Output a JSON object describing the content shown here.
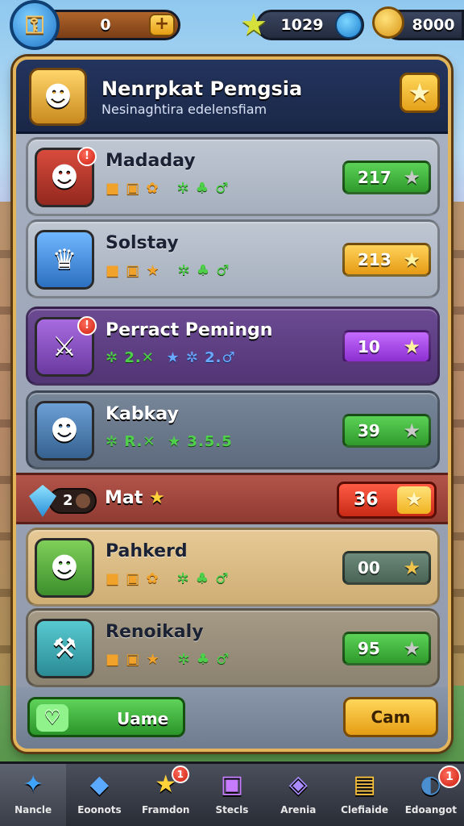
{
  "hud": {
    "keys": "0",
    "gems": "1029",
    "coins": "8000"
  },
  "header": {
    "title": "Nenrpkat Pemgsia",
    "subtitle": "Nesinaghtira edelensfiam"
  },
  "players": [
    {
      "name": "Madaday",
      "score": "217",
      "stats": [
        "⬛",
        "⬛",
        "⬛"
      ],
      "stats_text": [
        "■ ▣ ✿",
        "✲ ♣ ♂"
      ],
      "badge": "!"
    },
    {
      "name": "Solstay",
      "score": "213",
      "stats_text": [
        "■ ▣ ★",
        "✲ ♣ ♂"
      ],
      "badge": ""
    },
    {
      "name": "Perract Pemingn",
      "score": "10",
      "stats_text": [
        "✲ 2.✕",
        "★ ✲ 2.♂"
      ],
      "badge": "!"
    },
    {
      "name": "Kabkay",
      "score": "39",
      "stats_text": [
        "✲ R.✕",
        "★ 3.5.5"
      ],
      "badge": ""
    }
  ],
  "mine": {
    "rank": "2",
    "name": "Mat",
    "score": "36"
  },
  "players_below": [
    {
      "name": "Pahkerd",
      "score": "00",
      "stats_text": [
        "■ ▣ ✿",
        "✲ ♣ ♂"
      ]
    },
    {
      "name": "Renoikaly",
      "score": "95",
      "stats_text": [
        "■ ▣ ★",
        "✲ ♣ ♂"
      ]
    }
  ],
  "footer": {
    "left_button": "Uame",
    "right_button": "Cam"
  },
  "nav": [
    {
      "label": "Nancle",
      "icon": "✦",
      "badge": ""
    },
    {
      "label": "Eoonots",
      "icon": "◆",
      "badge": ""
    },
    {
      "label": "Framdon",
      "icon": "★",
      "badge": "1"
    },
    {
      "label": "Stecls",
      "icon": "▣",
      "badge": ""
    },
    {
      "label": "Arenia",
      "icon": "◈",
      "badge": ""
    },
    {
      "label": "Clefiaide",
      "icon": "▤",
      "badge": ""
    },
    {
      "label": "Edoangot",
      "icon": "◐",
      "badge": "1"
    }
  ]
}
